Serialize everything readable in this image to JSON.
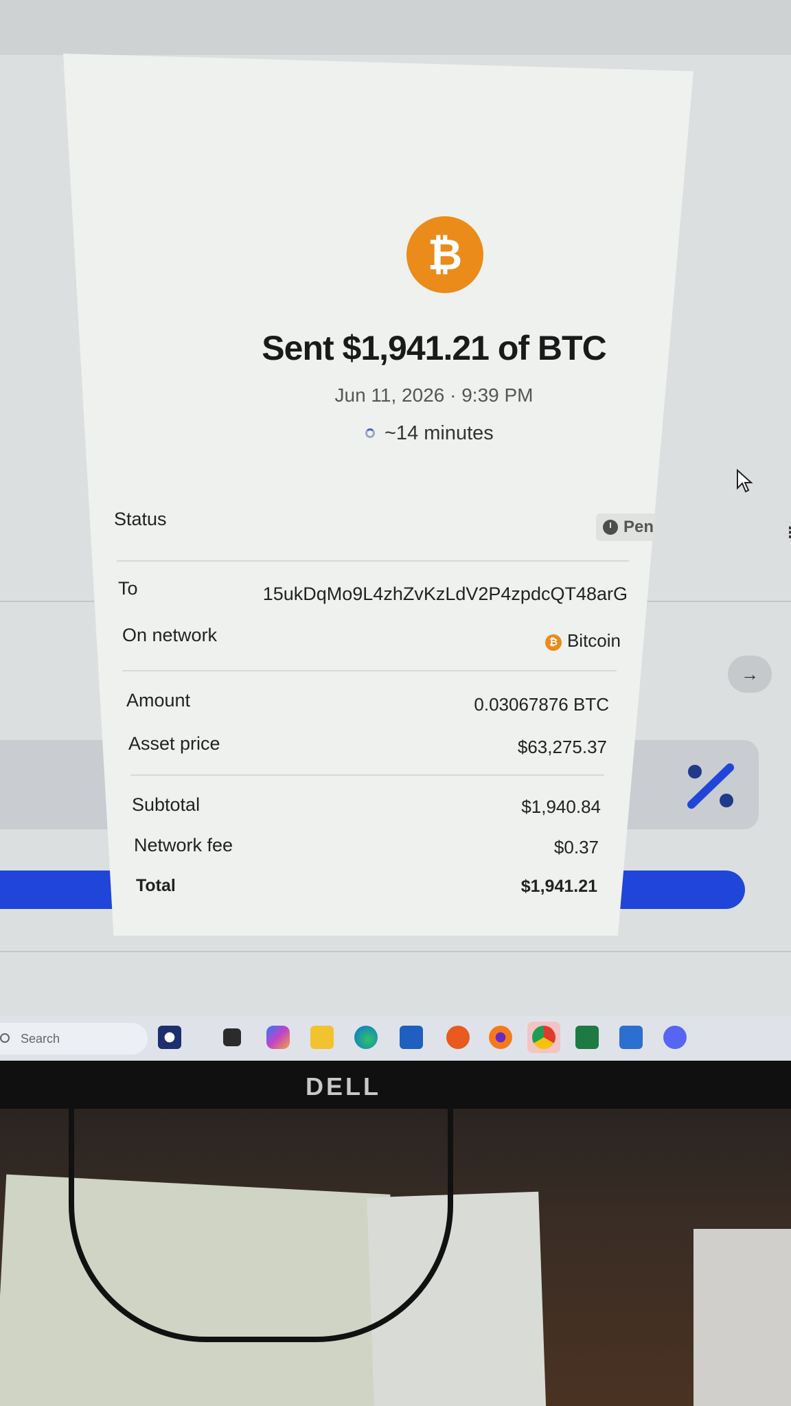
{
  "modal": {
    "close_icon": "close-icon",
    "coin_icon": "bitcoin-icon",
    "coin_symbol": "₿",
    "title": "Sent $1,941.21 of BTC",
    "date": "Jun 11, 2026 · 9:39 PM",
    "eta": "~14 minutes",
    "status": {
      "label": "Status",
      "value": "Pending"
    },
    "to": {
      "label": "To",
      "value": "15ukDqMo9L4zhZvKzLdV2P4zpdcQT48arG"
    },
    "network": {
      "label": "On network",
      "value": "Bitcoin"
    },
    "amount": {
      "label": "Amount",
      "value": "0.03067876 BTC"
    },
    "asset_price": {
      "label": "Asset price",
      "value": "$63,275.37"
    },
    "subtotal": {
      "label": "Subtotal",
      "value": "$1,940.84"
    },
    "network_fee": {
      "label": "Network fee",
      "value": "$0.37"
    },
    "total": {
      "label": "Total",
      "value": "$1,941.21"
    }
  },
  "background": {
    "arrow_label": "→",
    "kebab_label": "⋮",
    "accent_color": "#1f46d8"
  },
  "taskbar": {
    "search_placeholder": "Search"
  },
  "monitor": {
    "brand": "DELL"
  },
  "colors": {
    "bitcoin_orange": "#ea8b1a",
    "modal_bg": "#eef1ee"
  }
}
